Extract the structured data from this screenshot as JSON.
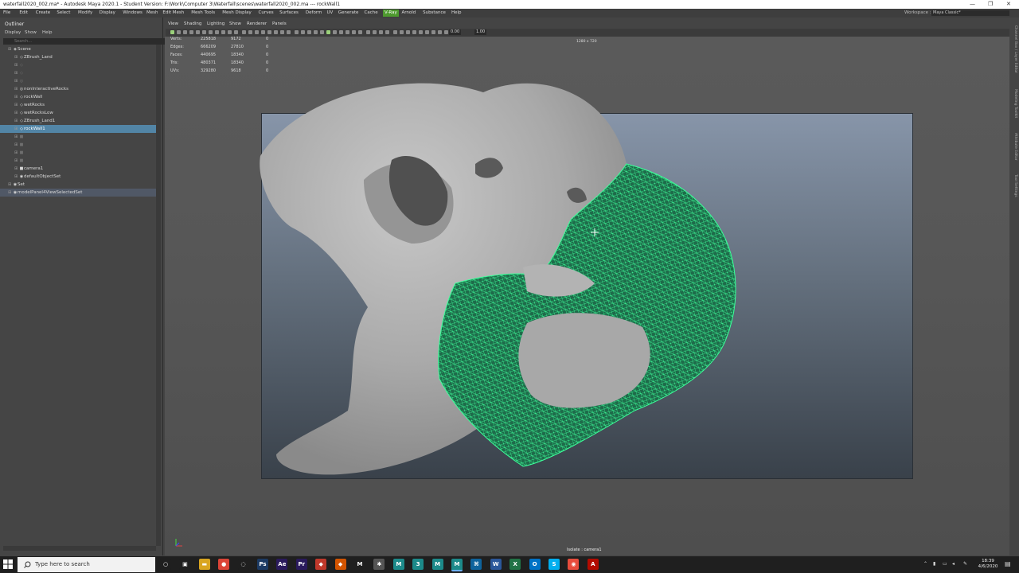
{
  "titlebar": {
    "title": "waterfall2020_002.ma* - Autodesk Maya 2020.1 - Student Version: F:\\Work\\Computer 3\\Waterfall\\scenes\\waterfall2020_002.ma  ---  rockWall1",
    "minimize": "—",
    "restore": "❐",
    "close": "✕"
  },
  "menubar": {
    "items": [
      "File",
      "Edit",
      "Create",
      "Select",
      "Modify",
      "Display",
      "Windows",
      "Mesh",
      "Edit Mesh",
      "Mesh Tools",
      "Mesh Display",
      "Curves",
      "Surfaces",
      "Deform",
      "UV",
      "Generate",
      "Cache",
      "V-Ray",
      "Arnold",
      "Substance",
      "Help"
    ],
    "highlight": "V-Ray",
    "workspace_label": "Workspace :",
    "workspace_value": "Maya Classic*"
  },
  "outliner": {
    "title": "Outliner",
    "menu": [
      "Display",
      "Show",
      "Help"
    ],
    "search_placeholder": "Search...",
    "items": [
      {
        "label": "Scene",
        "indent": 1,
        "dim": false,
        "icon": "scene-icon"
      },
      {
        "label": "ZBrush_Land",
        "indent": 2,
        "dim": false,
        "icon": "mesh-icon"
      },
      {
        "label": "",
        "indent": 2,
        "dim": true,
        "icon": "mesh-icon"
      },
      {
        "label": "",
        "indent": 2,
        "dim": true,
        "icon": "mesh-icon"
      },
      {
        "label": "",
        "indent": 2,
        "dim": true,
        "icon": "group-icon"
      },
      {
        "label": "nonInteractiveRocks",
        "indent": 2,
        "dim": false,
        "icon": "group-icon"
      },
      {
        "label": "rockWall",
        "indent": 2,
        "dim": false,
        "icon": "mesh-icon"
      },
      {
        "label": "wetRocks",
        "indent": 2,
        "dim": false,
        "icon": "mesh-icon"
      },
      {
        "label": "wetRocksLow",
        "indent": 2,
        "dim": false,
        "icon": "mesh-icon"
      },
      {
        "label": "ZBrush_Land1",
        "indent": 2,
        "dim": false,
        "icon": "mesh-icon"
      },
      {
        "label": "rockWall1",
        "indent": 2,
        "dim": false,
        "icon": "mesh-icon",
        "selected": true
      },
      {
        "label": "",
        "indent": 2,
        "dim": true,
        "icon": "camera-icon"
      },
      {
        "label": "",
        "indent": 2,
        "dim": true,
        "icon": "camera-icon"
      },
      {
        "label": "",
        "indent": 2,
        "dim": true,
        "icon": "camera-icon"
      },
      {
        "label": "",
        "indent": 2,
        "dim": true,
        "icon": "camera-icon"
      },
      {
        "label": "camera1",
        "indent": 2,
        "dim": false,
        "icon": "camera-icon"
      },
      {
        "label": "defaultObjectSet",
        "indent": 2,
        "dim": false,
        "icon": "set-icon"
      },
      {
        "label": "Set",
        "indent": 1,
        "dim": false,
        "icon": "set-icon"
      },
      {
        "label": "modelPanel4ViewSelectedSet",
        "indent": 1,
        "dim": false,
        "icon": "set-icon",
        "setrow": true
      }
    ]
  },
  "viewport": {
    "menu": [
      "View",
      "Shading",
      "Lighting",
      "Show",
      "Renderer",
      "Panels"
    ],
    "toolbar_field1": "0.00",
    "toolbar_field2": "1.00",
    "resolution_gate": "1280 x 720",
    "isolate_label": "Isolate : camera1",
    "hud": [
      {
        "label": "Verts:",
        "a": "225818",
        "b": "9172",
        "c": "0"
      },
      {
        "label": "Edges:",
        "a": "666209",
        "b": "27810",
        "c": "0"
      },
      {
        "label": "Faces:",
        "a": "440695",
        "b": "18340",
        "c": "0"
      },
      {
        "label": "Tris:",
        "a": "480371",
        "b": "18340",
        "c": "0"
      },
      {
        "label": "UVs:",
        "a": "329280",
        "b": "9618",
        "c": "0"
      }
    ]
  },
  "right_strip": [
    "Channel Box / Layer Editor",
    "Modeling Toolkit",
    "Attribute Editor",
    "Tool Settings"
  ],
  "taskbar": {
    "search_placeholder": "Type here to search",
    "apps": [
      {
        "name": "cortana-icon",
        "glyph": "○",
        "color": "#1f1f1f"
      },
      {
        "name": "task-view-icon",
        "glyph": "▣",
        "color": "#1f1f1f"
      },
      {
        "name": "file-explorer-icon",
        "glyph": "▬",
        "color": "#d9a520"
      },
      {
        "name": "chrome-icon",
        "glyph": "●",
        "color": "#db4437"
      },
      {
        "name": "app-icon",
        "glyph": "◌",
        "color": "#1f1f1f"
      },
      {
        "name": "photoshop-icon",
        "glyph": "Ps",
        "color": "#1c3a63"
      },
      {
        "name": "after-effects-icon",
        "glyph": "Ae",
        "color": "#2a1a5c"
      },
      {
        "name": "premiere-icon",
        "glyph": "Pr",
        "color": "#2a1a5c"
      },
      {
        "name": "app2-icon",
        "glyph": "◆",
        "color": "#c0392b"
      },
      {
        "name": "app3-icon",
        "glyph": "◆",
        "color": "#d35400"
      },
      {
        "name": "maya-m-icon",
        "glyph": "M",
        "color": "#1f1f1f"
      },
      {
        "name": "app4-icon",
        "glyph": "✱",
        "color": "#555"
      },
      {
        "name": "maya-icon",
        "glyph": "M",
        "color": "#1c8a8a"
      },
      {
        "name": "app5-icon",
        "glyph": "3",
        "color": "#1c8a8a"
      },
      {
        "name": "maya2-icon",
        "glyph": "M",
        "color": "#1c8a8a"
      },
      {
        "name": "maya-active-icon",
        "glyph": "M",
        "color": "#1c8a8a",
        "active": true
      },
      {
        "name": "vscode-icon",
        "glyph": "⌘",
        "color": "#0e639c"
      },
      {
        "name": "word-icon",
        "glyph": "W",
        "color": "#2b579a"
      },
      {
        "name": "excel-icon",
        "glyph": "X",
        "color": "#217346"
      },
      {
        "name": "outlook-icon",
        "glyph": "O",
        "color": "#0072c6"
      },
      {
        "name": "skype-icon",
        "glyph": "S",
        "color": "#00aff0"
      },
      {
        "name": "app6-icon",
        "glyph": "◉",
        "color": "#e74c3c"
      },
      {
        "name": "acrobat-icon",
        "glyph": "A",
        "color": "#b30b00"
      }
    ],
    "time": "18:39",
    "date": "4/6/2020"
  }
}
